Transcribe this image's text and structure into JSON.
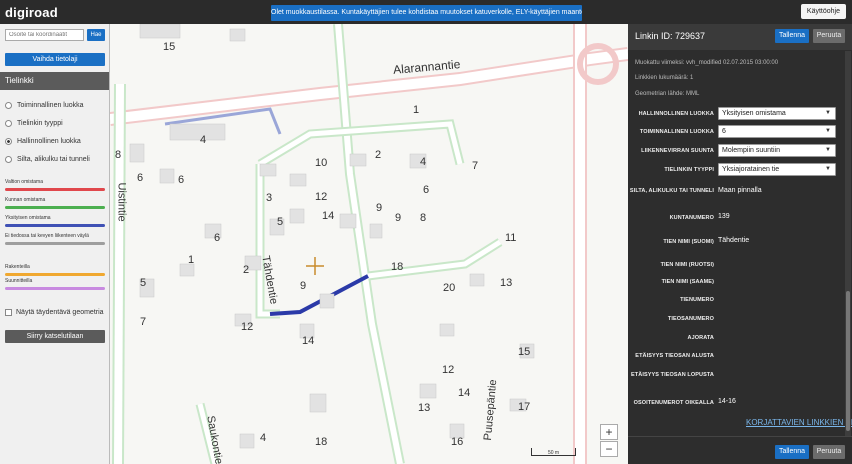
{
  "topbar": {
    "logo": "digiroad",
    "notice": "Olet muokkaustilassa. Kuntakäyttäjien tulee kohdistaa muutokset katuverkolle, ELY-käyttäjien maanteeverkolle.",
    "help_label": "Käyttöohje"
  },
  "sidebar": {
    "search_placeholder": "Osoite tai koordinaatit",
    "search_button": "Hae",
    "layer_button": "Vaihda tietolaji",
    "section_title": "Tielinkki",
    "radio_items": [
      {
        "label": "Toiminnallinen luokka",
        "checked": false
      },
      {
        "label": "Tielinkin tyyppi",
        "checked": false
      },
      {
        "label": "Hallinnollinen luokka",
        "checked": true
      },
      {
        "label": "Silta, alikulku tai tunneli",
        "checked": false
      }
    ],
    "legend": [
      {
        "label": "Valtion omistama",
        "color": "#e0474c"
      },
      {
        "label": "Kunnan omistama",
        "color": "#4caf50"
      },
      {
        "label": "Yksityisen omistama",
        "color": "#3f51b5"
      },
      {
        "label": "Ei tiedossa tai kevyen liikenteen väylä",
        "color": "#9e9e9e"
      },
      {
        "label": "Rakenteilla",
        "color": "#f0a830"
      },
      {
        "label": "Suunnitteilla",
        "color": "#c88ae0"
      }
    ],
    "complement_label": "Näytä täydentävä geometria",
    "view_mode_button": "Siirry katselutilaan"
  },
  "map": {
    "street_labels": [
      "Alarannantie",
      "Uistintie",
      "Tähdentie",
      "Puusepäntie",
      "Saukontie"
    ],
    "house_numbers": [
      "15",
      "4",
      "8",
      "6",
      "6",
      "10",
      "2",
      "4",
      "7",
      "3",
      "12",
      "6",
      "5",
      "14",
      "9",
      "9",
      "8",
      "1",
      "6",
      "1",
      "2",
      "11",
      "18",
      "5",
      "9",
      "20",
      "13",
      "7",
      "12",
      "14",
      "15",
      "12",
      "14",
      "13",
      "17",
      "4",
      "18",
      "16",
      "5",
      "1"
    ],
    "zoom_in": "+",
    "zoom_out": "−",
    "scale_label": "50 m"
  },
  "panel": {
    "link_id": "Linkin ID: 729637",
    "save_label": "Tallenna",
    "cancel_label": "Peruuta",
    "modified": "Muokattu viimeksi: vvh_modified 02.07.2015 03:00:00",
    "link_count": "Linkkien lukumäärä: 1",
    "geometry_source": "Geometrian lähde: MML",
    "fields": [
      {
        "label": "Hallinnollinen luokka",
        "value": "Yksityisen omistama",
        "type": "select"
      },
      {
        "label": "Toiminnallinen luokka",
        "value": "6",
        "type": "select"
      },
      {
        "label": "Liikennevirran suunta",
        "value": "Molempiin suuntiin",
        "type": "select"
      },
      {
        "label": "Tielinkin tyyppi",
        "value": "Yksiajoratainen tie",
        "type": "select"
      },
      {
        "label": "Silta, alikulku tai tunneli",
        "value": "Maan pinnalla",
        "type": "text"
      },
      {
        "label": "Kuntanumero",
        "value": "139",
        "type": "text"
      },
      {
        "label": "Tien nimi (Suomi)",
        "value": "Tähdentie",
        "type": "text"
      },
      {
        "label": "Tien nimi (Ruotsi)",
        "value": "",
        "type": "text"
      },
      {
        "label": "Tien nimi (Saame)",
        "value": "",
        "type": "text"
      },
      {
        "label": "Tienumero",
        "value": "",
        "type": "text"
      },
      {
        "label": "Tieosanumero",
        "value": "",
        "type": "text"
      },
      {
        "label": "Ajorata",
        "value": "",
        "type": "text"
      },
      {
        "label": "Etäisyys tieosan alusta",
        "value": "",
        "type": "text"
      },
      {
        "label": "Etäisyys tieosan lopusta",
        "value": "",
        "type": "text"
      },
      {
        "label": "Osoitenumerot oikealla",
        "value": "14-16",
        "type": "text"
      }
    ],
    "fix_list_link": "KORJATTAVIEN LINKKIEN LISTA"
  }
}
